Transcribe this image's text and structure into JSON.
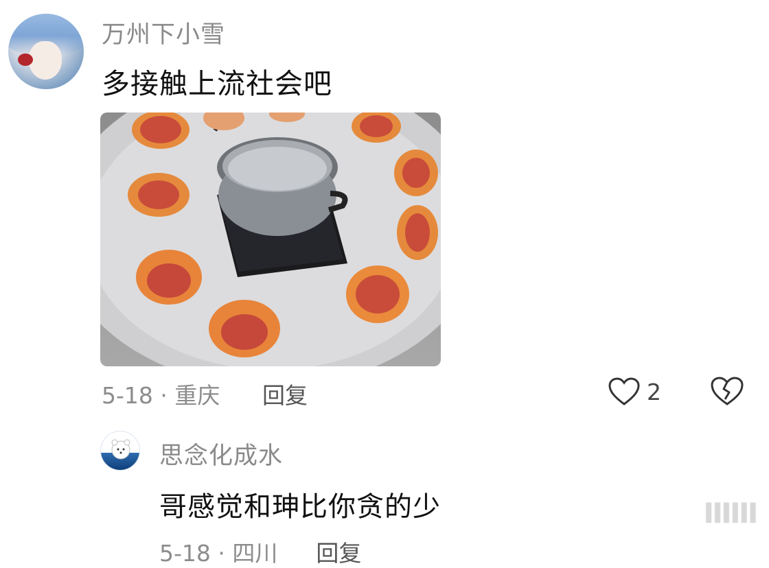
{
  "comment": {
    "username": "万州下小雪",
    "text": "多接触上流社会吧",
    "meta": "5-18 · 重庆",
    "reply_label": "回复",
    "like_count": "2",
    "icons": {
      "like": "heart-outline-icon",
      "dislike": "broken-heart-icon"
    }
  },
  "reply": {
    "username": "思念化成水",
    "text": "哥感觉和珅比你贪的少",
    "meta": "5-18 · 四川",
    "reply_label": "回复"
  },
  "watermark": "IIIIII"
}
